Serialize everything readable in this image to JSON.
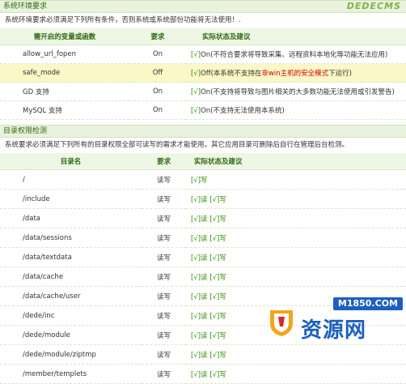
{
  "env": {
    "title": "系统环境要求",
    "logo": "DEDECMS",
    "note": "系统环境要求必须满足下列所有条件，否则系统或系统部份功能将无法使用！.",
    "headers": [
      "需开启的变量或函数",
      "要求",
      "实际状态及建议"
    ],
    "rows": [
      {
        "name": "allow_url_fopen",
        "req": "On",
        "check": "[√]",
        "state": "On(不符合要求将导致采集、远程资料本地化等功能无法应用)"
      },
      {
        "name": "safe_mode",
        "req": "Off",
        "check": "[√]",
        "state": "Off(本系统不支持在非win主机的安全模式下运行)"
      },
      {
        "name": "GD 支持",
        "req": "On",
        "check": "[√]",
        "state": "On(不支持将导致与图片相关的大多数功能无法使用或引发警告)"
      },
      {
        "name": "MySQL 支持",
        "req": "On",
        "check": "[√]",
        "state": "On(不支持无法使用本系统)"
      }
    ]
  },
  "dirs": {
    "title": "目录权限检测",
    "note": "系统要求必须满足下列所有的目录权限全部可读写的需求才能使用，其它应用目录可删除后自行在管理后台检测。",
    "headers": [
      "目录名",
      "要求",
      "实际状态及建议"
    ],
    "rows": [
      {
        "name": "/",
        "req": "读写",
        "read": "",
        "write": "[√]写"
      },
      {
        "name": "/include",
        "req": "读写",
        "read": "[√]读",
        "write": "[√]写"
      },
      {
        "name": "/data",
        "req": "读写",
        "read": "[√]读",
        "write": "[√]写"
      },
      {
        "name": "/data/sessions",
        "req": "读写",
        "read": "[√]读",
        "write": "[√]写"
      },
      {
        "name": "/data/textdata",
        "req": "读写",
        "read": "[√]读",
        "write": "[√]写"
      },
      {
        "name": "/data/cache",
        "req": "读写",
        "read": "[√]读",
        "write": "[√]写"
      },
      {
        "name": "/data/cache/user",
        "req": "读写",
        "read": "[√]读",
        "write": "[√]写"
      },
      {
        "name": "/dede/inc",
        "req": "读写",
        "read": "[√]读",
        "write": "[√]写"
      },
      {
        "name": "/dede/module",
        "req": "读写",
        "read": "[√]读",
        "write": "[√]写"
      },
      {
        "name": "/dede/module/ziptmp",
        "req": "读写",
        "read": "[√]读",
        "write": "[√]写"
      },
      {
        "name": "/member/templets",
        "req": "读写",
        "read": "[√]读",
        "write": "[√]写"
      }
    ]
  },
  "watermark": {
    "url": "M1850.COM",
    "text": "资源网"
  }
}
